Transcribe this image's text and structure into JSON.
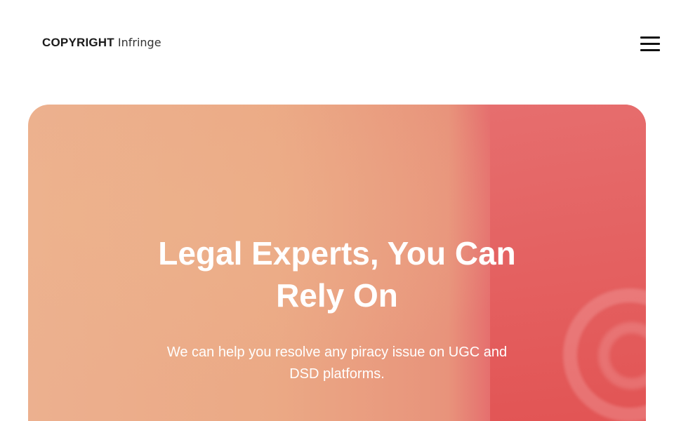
{
  "header": {
    "logo_strong": "COPYRIGHT",
    "logo_light": "Infringe",
    "menu_icon": "hamburger-menu-icon"
  },
  "hero": {
    "title": "Legal Experts, You Can Rely On",
    "subtitle": "We can help you resolve any piracy issue on UGC and DSD platforms."
  },
  "colors": {
    "hero_gradient_start": "#ecb08f",
    "hero_gradient_end": "#e35858",
    "hero_text": "#ffffff",
    "logo_text": "#1a1a1a"
  }
}
